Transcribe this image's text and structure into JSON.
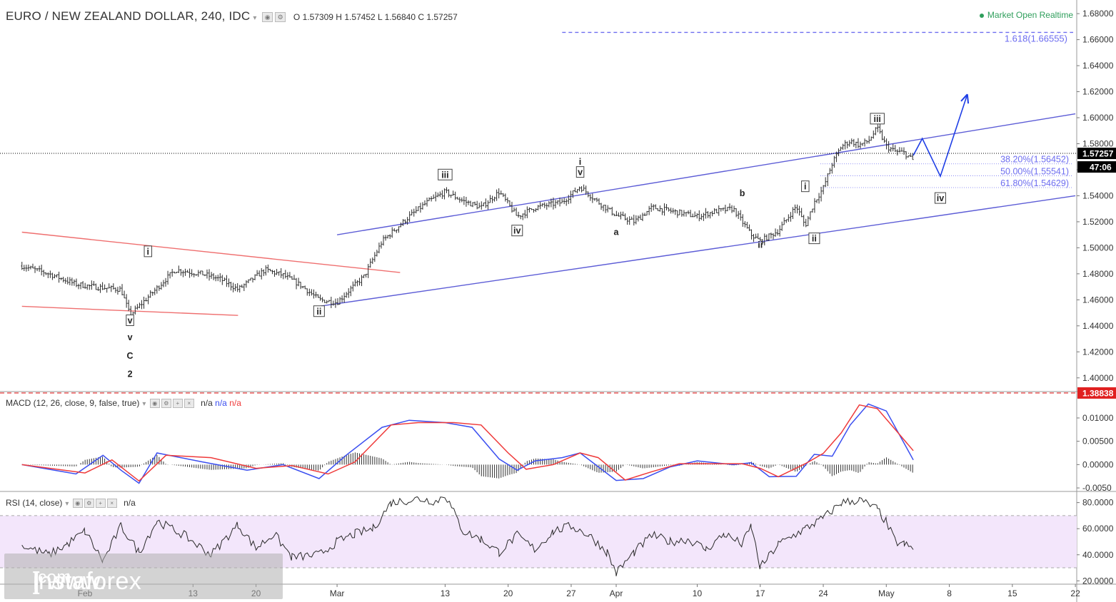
{
  "header": {
    "symbol": "EURO / NEW ZEALAND DOLLAR, 240, IDC",
    "o_label": "O",
    "o_value": "1.57309",
    "h_label": "H",
    "h_value": "1.57452",
    "l_label": "L",
    "l_value": "1.56840",
    "c_label": "C",
    "c_value": "1.57257",
    "market_status": "Market Open",
    "feed_status": "Realtime"
  },
  "macd_panel": {
    "label": "MACD (12, 26, close, 9, false, true)",
    "v1": "n/a",
    "v2": "n/a",
    "v3": "n/a"
  },
  "rsi_panel": {
    "label": "RSI (14, close)",
    "v1": "n/a"
  },
  "watermark": {
    "prefix": "[ www.",
    "brand": "instaforex",
    "suffix": ".com",
    "close": "]"
  },
  "colors": {
    "channel": "#5c5cd6",
    "old_channel": "#ef6f6f",
    "arrow": "#1f3fe6",
    "macd": "#3a4ef0",
    "signal": "#ef3a3a",
    "rsi": "#2a2a2a",
    "rsi_band": "#f3e6fb",
    "current_price": "#000000",
    "support": "#e02020",
    "fib": "#6d6df0"
  },
  "chart_data": [
    {
      "type": "ohlc",
      "name": "main",
      "ylim": [
        1.39,
        1.685
      ],
      "y_ticks": [
        "1.68000",
        "1.66000",
        "1.64000",
        "1.62000",
        "1.60000",
        "1.58000",
        "1.56000",
        "1.54000",
        "1.52000",
        "1.50000",
        "1.48000",
        "1.46000",
        "1.44000",
        "1.42000",
        "1.40000"
      ],
      "y_tick_values": [
        1.68,
        1.66,
        1.64,
        1.62,
        1.6,
        1.58,
        1.56,
        1.54,
        1.52,
        1.5,
        1.48,
        1.46,
        1.44,
        1.42,
        1.4
      ],
      "x_labels": [
        "Feb",
        "13",
        "20",
        "Mar",
        "13",
        "20",
        "27",
        "Apr",
        "10",
        "17",
        "24",
        "May",
        "8",
        "15",
        "22"
      ],
      "x_label_dates": [
        "2018-02-01",
        "2018-02-13",
        "2018-02-20",
        "2018-03-01",
        "2018-03-13",
        "2018-03-20",
        "2018-03-27",
        "2018-04-01",
        "2018-04-10",
        "2018-04-17",
        "2018-04-24",
        "2018-05-01",
        "2018-05-08",
        "2018-05-15",
        "2018-05-22"
      ],
      "price_series": {
        "dates": [
          "2018-01-25",
          "2018-01-28",
          "2018-01-31",
          "2018-02-02",
          "2018-02-05",
          "2018-02-06",
          "2018-02-08",
          "2018-02-11",
          "2018-02-14",
          "2018-02-16",
          "2018-02-18",
          "2018-02-21",
          "2018-02-23",
          "2018-02-25",
          "2018-02-27",
          "2018-03-01",
          "2018-03-02",
          "2018-03-04",
          "2018-03-06",
          "2018-03-09",
          "2018-03-11",
          "2018-03-13",
          "2018-03-15",
          "2018-03-17",
          "2018-03-19",
          "2018-03-21",
          "2018-03-23",
          "2018-03-26",
          "2018-03-28",
          "2018-03-30",
          "2018-04-01",
          "2018-04-03",
          "2018-04-05",
          "2018-04-08",
          "2018-04-10",
          "2018-04-12",
          "2018-04-14",
          "2018-04-16",
          "2018-04-17",
          "2018-04-19",
          "2018-04-21",
          "2018-04-22",
          "2018-04-23",
          "2018-04-24",
          "2018-04-25",
          "2018-04-26",
          "2018-04-27",
          "2018-04-28",
          "2018-04-29",
          "2018-04-30",
          "2018-05-01",
          "2018-05-02",
          "2018-05-03",
          "2018-05-04"
        ],
        "close": [
          1.486,
          1.48,
          1.472,
          1.47,
          1.468,
          1.448,
          1.462,
          1.483,
          1.48,
          1.476,
          1.468,
          1.483,
          1.479,
          1.471,
          1.46,
          1.458,
          1.465,
          1.478,
          1.505,
          1.524,
          1.535,
          1.543,
          1.536,
          1.531,
          1.543,
          1.524,
          1.531,
          1.535,
          1.547,
          1.535,
          1.525,
          1.52,
          1.531,
          1.527,
          1.524,
          1.528,
          1.53,
          1.51,
          1.505,
          1.513,
          1.532,
          1.517,
          1.535,
          1.546,
          1.565,
          1.578,
          1.582,
          1.579,
          1.582,
          1.592,
          1.578,
          1.574,
          1.573,
          1.567
        ],
        "ohlc_last": {
          "open": 1.57309,
          "high": 1.57452,
          "low": 1.5684,
          "close": 1.57257
        }
      },
      "current_price": "1.57257",
      "countdown": "47:06",
      "support_level": "1.38838",
      "fib_target": {
        "label": "1.618(1.66555)",
        "value": 1.66555
      },
      "fib_retracements": [
        {
          "label": "38.20%(1.56452)",
          "value": 1.56452
        },
        {
          "label": "50.00%(1.55541)",
          "value": 1.55541
        },
        {
          "label": "61.80%(1.54629)",
          "value": 1.54629
        }
      ],
      "wave_labels": [
        {
          "text": "i",
          "boxed": true,
          "date": "2018-02-08",
          "price": 1.497
        },
        {
          "text": "v",
          "boxed": true,
          "date": "2018-02-06",
          "price": 1.444
        },
        {
          "text": "v",
          "boxed": false,
          "date": "2018-02-06",
          "price": 1.431
        },
        {
          "text": "C",
          "boxed": false,
          "date": "2018-02-06",
          "price": 1.417
        },
        {
          "text": "2",
          "boxed": false,
          "date": "2018-02-06",
          "price": 1.403
        },
        {
          "text": "ii",
          "boxed": true,
          "date": "2018-02-27",
          "price": 1.451
        },
        {
          "text": "iii",
          "boxed": true,
          "date": "2018-03-13",
          "price": 1.556
        },
        {
          "text": "iv",
          "boxed": true,
          "date": "2018-03-21",
          "price": 1.513
        },
        {
          "text": "v",
          "boxed": true,
          "date": "2018-03-28",
          "price": 1.558
        },
        {
          "text": "i",
          "boxed": false,
          "date": "2018-03-28",
          "price": 1.566
        },
        {
          "text": "a",
          "boxed": false,
          "date": "2018-04-01",
          "price": 1.512
        },
        {
          "text": "b",
          "boxed": false,
          "date": "2018-04-15",
          "price": 1.542
        },
        {
          "text": "ii",
          "boxed": false,
          "date": "2018-04-17",
          "price": 1.502
        },
        {
          "text": "i",
          "boxed": true,
          "date": "2018-04-22",
          "price": 1.547
        },
        {
          "text": "ii",
          "boxed": true,
          "date": "2018-04-23",
          "price": 1.507
        },
        {
          "text": "iii",
          "boxed": true,
          "date": "2018-04-30",
          "price": 1.599
        },
        {
          "text": "iv",
          "boxed": true,
          "date": "2018-05-07",
          "price": 1.538
        }
      ],
      "channel": {
        "upper": [
          [
            "2018-03-01",
            1.51
          ],
          [
            "2018-05-22",
            1.603
          ]
        ],
        "lower": [
          [
            "2018-02-27",
            1.455
          ],
          [
            "2018-05-22",
            1.54
          ]
        ]
      },
      "old_channel": {
        "upper": [
          [
            "2018-01-25",
            1.512
          ],
          [
            "2018-03-08",
            1.481
          ]
        ],
        "lower": [
          [
            "2018-01-25",
            1.455
          ],
          [
            "2018-02-18",
            1.448
          ]
        ]
      },
      "projection": [
        [
          "2018-05-04",
          1.571
        ],
        [
          "2018-05-05",
          1.584
        ],
        [
          "2018-05-07",
          1.555
        ],
        [
          "2018-05-10",
          1.618
        ]
      ]
    },
    {
      "type": "line",
      "name": "MACD",
      "ylim": [
        -0.0056,
        0.0155
      ],
      "y_ticks": [
        "0.01000",
        "0.00500",
        "0.00000",
        "-0.0050"
      ],
      "y_tick_values": [
        0.01,
        0.005,
        0.0,
        -0.005
      ],
      "series": [
        {
          "name": "MACD",
          "dates": [
            "2018-01-25",
            "2018-01-31",
            "2018-02-03",
            "2018-02-05",
            "2018-02-07",
            "2018-02-09",
            "2018-02-14",
            "2018-02-19",
            "2018-02-23",
            "2018-02-27",
            "2018-03-02",
            "2018-03-06",
            "2018-03-09",
            "2018-03-13",
            "2018-03-16",
            "2018-03-19",
            "2018-03-21",
            "2018-03-23",
            "2018-03-26",
            "2018-03-28",
            "2018-04-01",
            "2018-04-04",
            "2018-04-07",
            "2018-04-10",
            "2018-04-14",
            "2018-04-16",
            "2018-04-18",
            "2018-04-21",
            "2018-04-23",
            "2018-04-25",
            "2018-04-27",
            "2018-04-29",
            "2018-05-01",
            "2018-05-03",
            "2018-05-04"
          ],
          "values": [
            0.0,
            -0.002,
            0.002,
            -0.0012,
            -0.004,
            0.0025,
            0.0006,
            -0.0012,
            0.0,
            -0.003,
            0.002,
            0.008,
            0.0095,
            0.009,
            0.008,
            0.0012,
            -0.0012,
            0.0008,
            0.0015,
            0.0025,
            -0.0034,
            -0.003,
            -0.0005,
            0.0008,
            0.0,
            0.0004,
            -0.0026,
            -0.0025,
            0.0022,
            0.0018,
            0.0085,
            0.013,
            0.0115,
            0.0045,
            0.001
          ]
        },
        {
          "name": "Signal",
          "dates": [
            "2018-01-25",
            "2018-02-01",
            "2018-02-04",
            "2018-02-07",
            "2018-02-10",
            "2018-02-15",
            "2018-02-20",
            "2018-02-24",
            "2018-02-28",
            "2018-03-03",
            "2018-03-07",
            "2018-03-10",
            "2018-03-14",
            "2018-03-17",
            "2018-03-20",
            "2018-03-22",
            "2018-03-25",
            "2018-03-28",
            "2018-03-30",
            "2018-04-02",
            "2018-04-05",
            "2018-04-08",
            "2018-04-11",
            "2018-04-15",
            "2018-04-17",
            "2018-04-19",
            "2018-04-22",
            "2018-04-24",
            "2018-04-26",
            "2018-04-28",
            "2018-04-30",
            "2018-05-02",
            "2018-05-04"
          ],
          "values": [
            0.0,
            -0.0018,
            0.001,
            -0.0035,
            0.002,
            0.0015,
            -0.0008,
            -0.0002,
            -0.002,
            0.0006,
            0.0085,
            0.009,
            0.009,
            0.0085,
            0.0025,
            -0.001,
            0.0,
            0.0025,
            0.0015,
            -0.0033,
            -0.0015,
            0.0002,
            0.0002,
            0.0002,
            -0.0008,
            -0.0026,
            0.0002,
            0.0024,
            0.0068,
            0.0128,
            0.012,
            0.0075,
            0.003
          ]
        }
      ]
    },
    {
      "type": "line",
      "name": "RSI",
      "ylim": [
        18,
        88
      ],
      "y_ticks": [
        "80.0000",
        "60.0000",
        "40.0000",
        "20.0000"
      ],
      "y_tick_values": [
        80,
        60,
        40,
        20
      ],
      "band": [
        30,
        70
      ],
      "series": [
        {
          "name": "RSI",
          "dates": [
            "2018-01-25",
            "2018-01-28",
            "2018-01-30",
            "2018-02-01",
            "2018-02-03",
            "2018-02-05",
            "2018-02-07",
            "2018-02-09",
            "2018-02-12",
            "2018-02-15",
            "2018-02-18",
            "2018-02-20",
            "2018-02-22",
            "2018-02-24",
            "2018-02-27",
            "2018-03-01",
            "2018-03-03",
            "2018-03-05",
            "2018-03-07",
            "2018-03-10",
            "2018-03-12",
            "2018-03-13",
            "2018-03-15",
            "2018-03-17",
            "2018-03-19",
            "2018-03-21",
            "2018-03-23",
            "2018-03-25",
            "2018-03-27",
            "2018-03-29",
            "2018-03-31",
            "2018-04-01",
            "2018-04-03",
            "2018-04-05",
            "2018-04-07",
            "2018-04-09",
            "2018-04-11",
            "2018-04-13",
            "2018-04-15",
            "2018-04-16",
            "2018-04-17",
            "2018-04-19",
            "2018-04-21",
            "2018-04-22",
            "2018-04-23",
            "2018-04-24",
            "2018-04-26",
            "2018-04-28",
            "2018-04-30",
            "2018-05-01",
            "2018-05-02",
            "2018-05-03",
            "2018-05-04"
          ],
          "values": [
            47,
            40,
            48,
            58,
            35,
            62,
            42,
            66,
            55,
            40,
            63,
            45,
            56,
            38,
            40,
            50,
            56,
            60,
            80,
            83,
            81,
            86,
            58,
            52,
            42,
            55,
            44,
            58,
            62,
            55,
            42,
            26,
            42,
            55,
            50,
            52,
            44,
            56,
            48,
            62,
            30,
            48,
            56,
            60,
            64,
            68,
            80,
            82,
            75,
            65,
            50,
            48,
            44
          ]
        }
      ]
    }
  ]
}
